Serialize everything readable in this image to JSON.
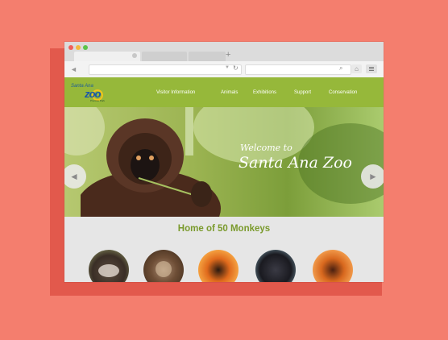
{
  "browser": {
    "new_tab_glyph": "+",
    "back_glyph": "◄",
    "reload_glyph": "↻",
    "search_glyph": "⌕",
    "home_glyph": "⌂"
  },
  "site": {
    "logo": {
      "top_text": "Santa Ana",
      "main_text": "zoo",
      "sub_text": "Prentice Park"
    },
    "nav": [
      "Visitor Information",
      "Animals",
      "Exhibitions",
      "Support",
      "Conservation"
    ],
    "hero": {
      "welcome": "Welcome to",
      "title": "Santa Ana Zoo",
      "prev_glyph": "◄",
      "next_glyph": "►"
    },
    "section_title": "Home of 50 Monkeys",
    "monkeys": [
      {
        "name": "emperor-tamarin",
        "color": "#6a5a4a"
      },
      {
        "name": "white-faced-monkey",
        "color": "#7a5a40"
      },
      {
        "name": "golden-lion-tamarin",
        "color": "#d9641e"
      },
      {
        "name": "black-monkey",
        "color": "#1e1e24"
      },
      {
        "name": "orange-monkey",
        "color": "#c8581c"
      }
    ]
  },
  "colors": {
    "background": "#f47e6e",
    "header_green": "#96b83a",
    "title_green": "#7a9a2c"
  }
}
